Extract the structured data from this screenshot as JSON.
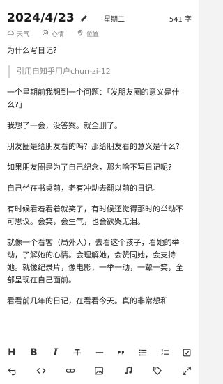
{
  "header": {
    "date": "2024/4/23",
    "weekday": "星期二",
    "word_count": "541 字"
  },
  "meta": {
    "weather_label": "天气",
    "mood_label": "心情",
    "location_label": "位置"
  },
  "content": {
    "title_question": "为什么写日记?",
    "quote": "引用自知乎用户chun-zi-12",
    "paragraphs": [
      "一个星期前我想到一个问题：「发朋友圈的意义是什么?」",
      "我想了一会，没答案。就全删了。",
      "朋友圈是给朋友看的吗？那给朋友看的意义是什么?",
      "如果朋友圈是为了自己纪念，那为啥不写日记呢?",
      "自己坐在书桌前，老有冲动去翻以前的日记。",
      "有时候看着看着就笑了，有时候还觉得那时的举动不可思议。会笑，会生气，也会欲哭无泪。",
      "就像一个看客（局外人），去看这个孩子，看她的举动，了解她的心情。会理解她，会赞同她，会支持她。就像纪录片，像电影，一举一动，一颦一笑，全部呈现在自己面前。",
      "看看前几年的日记，在看看今天。真的非常想和"
    ]
  },
  "toolbar": {
    "row1": [
      {
        "name": "heading-button",
        "icon": "H",
        "kind": "text"
      },
      {
        "name": "bold-button",
        "icon": "B",
        "kind": "text"
      },
      {
        "name": "italic-button",
        "icon": "I",
        "kind": "text"
      },
      {
        "name": "strikethrough-button",
        "icon": "strike-icon",
        "kind": "svg"
      },
      {
        "name": "horizontal-rule-button",
        "icon": "hr-icon",
        "kind": "svg"
      },
      {
        "name": "quote-button",
        "icon": "quote-icon",
        "kind": "svg"
      },
      {
        "name": "bullet-list-button",
        "icon": "bullet-list-icon",
        "kind": "svg"
      },
      {
        "name": "ordered-list-button",
        "icon": "ordered-list-icon",
        "kind": "svg"
      },
      {
        "name": "checklist-button",
        "icon": "checkbox-icon",
        "kind": "svg"
      }
    ],
    "row2": [
      {
        "name": "undo-button",
        "icon": "undo-icon"
      },
      {
        "name": "code-button",
        "icon": "code-icon"
      },
      {
        "name": "link-button",
        "icon": "link-icon"
      },
      {
        "name": "image-button",
        "icon": "image-icon"
      },
      {
        "name": "music-button",
        "icon": "music-icon"
      },
      {
        "name": "tag-button",
        "icon": "tag-icon"
      },
      {
        "name": "fullscreen-button",
        "icon": "expand-icon"
      }
    ]
  }
}
